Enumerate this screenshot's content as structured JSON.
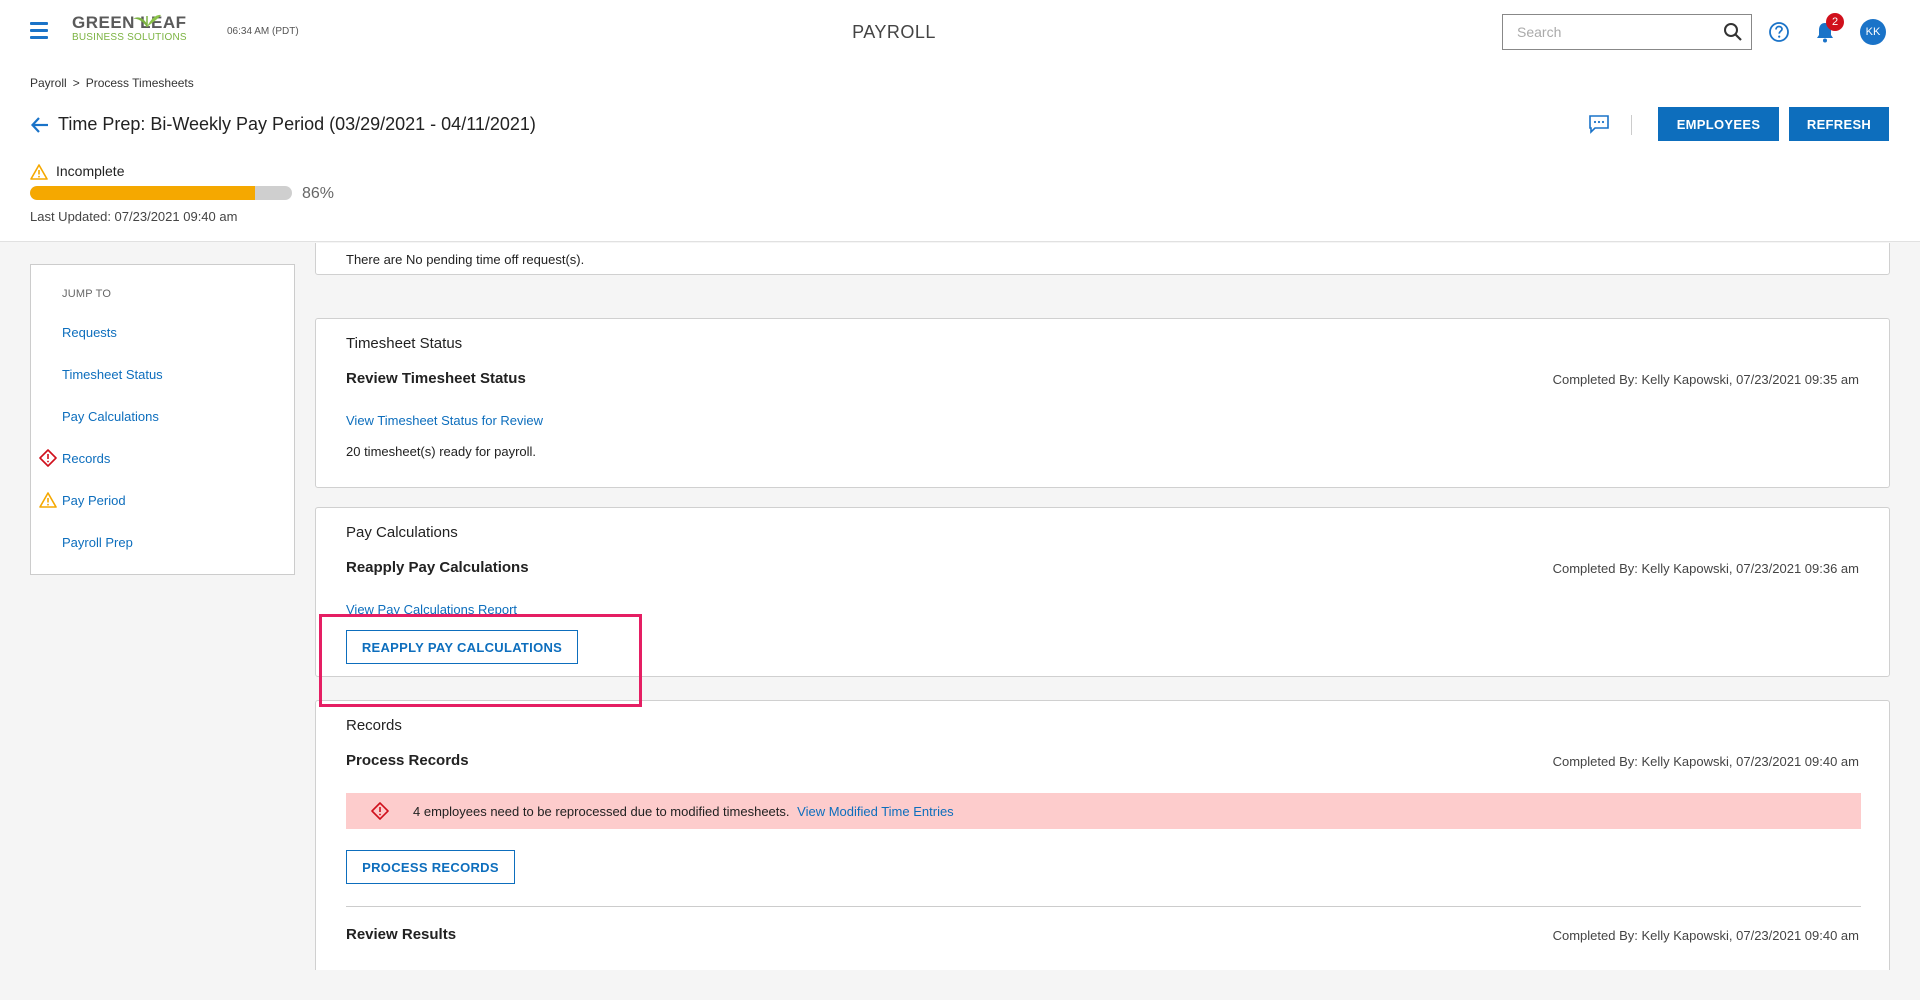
{
  "topbar": {
    "logo_top": "GREEN LEAF",
    "logo_bottom": "BUSINESS SOLUTIONS",
    "clock": "06:34 AM (PDT)",
    "app_title": "PAYROLL",
    "search_placeholder": "Search",
    "notification_count": "2",
    "avatar_initials": "KK"
  },
  "breadcrumb": {
    "root": "Payroll",
    "separator": ">",
    "current": "Process Timesheets"
  },
  "page": {
    "title": "Time Prep: Bi-Weekly Pay Period (03/29/2021 - 04/11/2021)",
    "employees_button": "EMPLOYEES",
    "refresh_button": "REFRESH",
    "status": "Incomplete",
    "progress_percent": 86,
    "progress_label": "86%",
    "last_updated": "Last Updated: 07/23/2021 09:40 am"
  },
  "jumpto": {
    "title": "JUMP TO",
    "items": [
      {
        "label": "Requests",
        "status": "none"
      },
      {
        "label": "Timesheet Status",
        "status": "none"
      },
      {
        "label": "Pay Calculations",
        "status": "none"
      },
      {
        "label": "Records",
        "status": "error"
      },
      {
        "label": "Pay Period",
        "status": "warning"
      },
      {
        "label": "Payroll Prep",
        "status": "none"
      }
    ]
  },
  "requests_card": {
    "partial_text": "There are No pending time off request(s)."
  },
  "timesheet_card": {
    "title": "Timesheet Status",
    "subtitle": "Review Timesheet Status",
    "completed": "Completed By: Kelly Kapowski, 07/23/2021 09:35 am",
    "link": "View Timesheet Status for Review",
    "text": "20 timesheet(s) ready for payroll."
  },
  "paycalc_card": {
    "title": "Pay Calculations",
    "subtitle": "Reapply Pay Calculations",
    "completed": "Completed By: Kelly Kapowski, 07/23/2021 09:36 am",
    "link": "View Pay Calculations Report",
    "button": "REAPPLY PAY CALCULATIONS"
  },
  "records_card": {
    "title": "Records",
    "subtitle": "Process Records",
    "completed": "Completed By: Kelly Kapowski, 07/23/2021 09:40 am",
    "alert_text": "4 employees need to be reprocessed due to modified timesheets.",
    "alert_link": "View Modified Time Entries",
    "button": "PROCESS RECORDS",
    "review_subtitle": "Review Results",
    "review_completed": "Completed By: Kelly Kapowski, 07/23/2021 09:40 am"
  },
  "colors": {
    "primary": "#0d6ebd",
    "warning": "#f5a800",
    "error": "#d0101c",
    "alert_bg": "#fdcccc",
    "highlight": "#e51e63",
    "logo_green": "#7cb342"
  },
  "icons": {
    "menu": "hamburger-icon",
    "search": "search-icon",
    "help": "help-circle-icon",
    "notifications": "bell-icon",
    "back": "arrow-left-icon",
    "comments": "chat-bubble-icon",
    "warning": "warning-triangle-icon",
    "error": "error-diamond-icon"
  }
}
